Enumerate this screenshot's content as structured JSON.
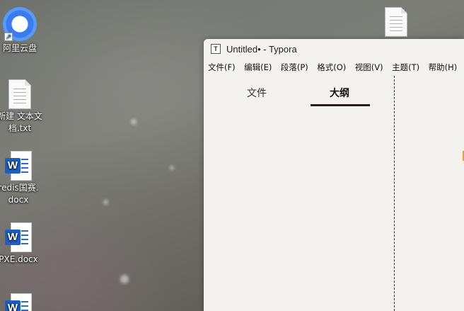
{
  "desktop": {
    "icons": [
      {
        "label": "阿里云盘",
        "icon": "aliyun-drive-icon"
      },
      {
        "label": "新建 文本文\n档.txt",
        "icon": "text-file-icon"
      },
      {
        "label": "redis国赛.\ndocx",
        "icon": "word-doc-icon"
      },
      {
        "label": "PXE.docx",
        "icon": "word-doc-icon"
      },
      {
        "label": "",
        "icon": "word-doc-icon"
      },
      {
        "label": "",
        "icon": "text-file-icon"
      }
    ]
  },
  "window": {
    "app_icon": "T",
    "title": "Untitled• - Typora",
    "menu": [
      "文件(F)",
      "编辑(E)",
      "段落(P)",
      "格式(O)",
      "视图(V)",
      "主题(T)",
      "帮助(H)"
    ],
    "sidebar": {
      "tabs": [
        "文件",
        "大纲"
      ],
      "active_tab": "大纲"
    }
  },
  "colors": {
    "window_bg": "#f3f2ee",
    "tab_underline": "#2a1a1a",
    "word_blue": "#1f5fbf",
    "drive_blue": "#3a7bf0"
  }
}
